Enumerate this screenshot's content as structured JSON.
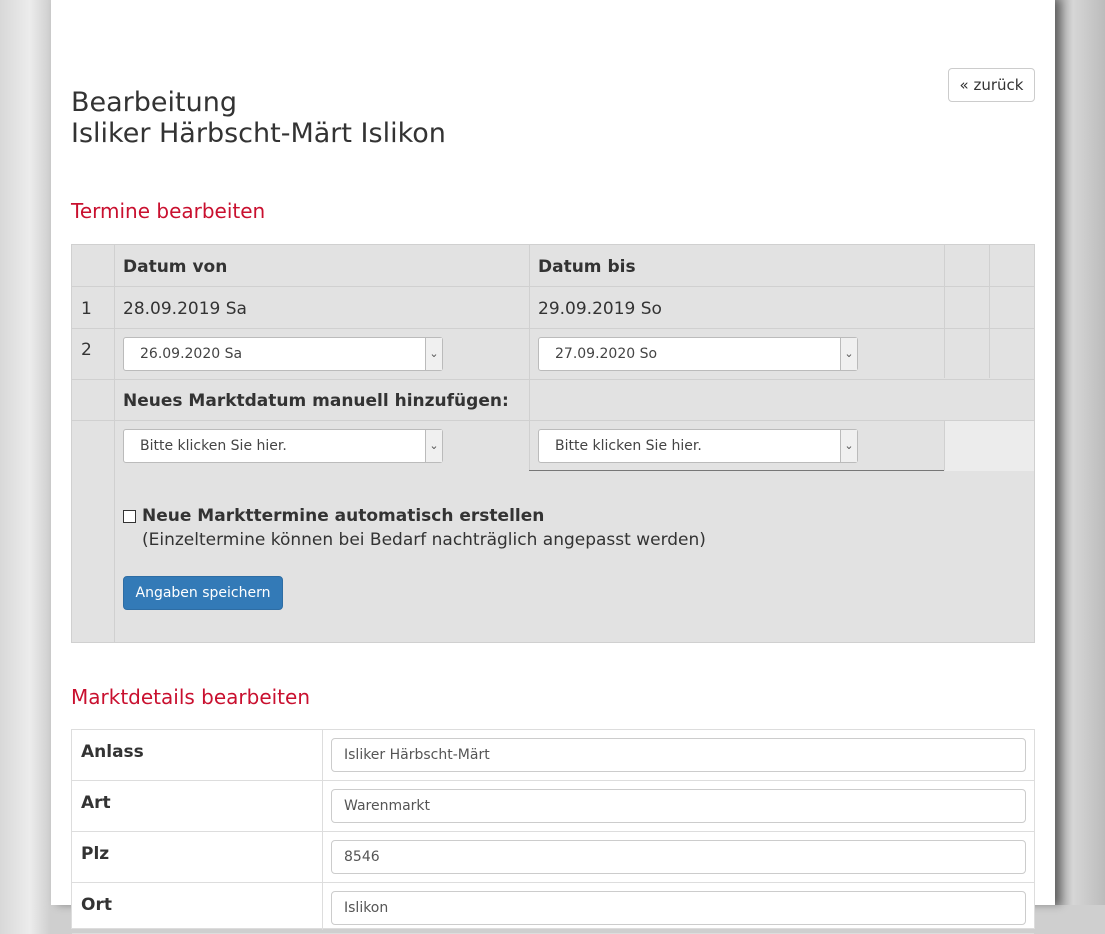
{
  "nav": {
    "back_label": "« zurück"
  },
  "page": {
    "title_line1": "Bearbeitung",
    "title_line2": "Isliker Härbscht-Märt Islikon"
  },
  "termine": {
    "section_title": "Termine bearbeiten",
    "columns": {
      "von": "Datum von",
      "bis": "Datum bis"
    },
    "rows": [
      {
        "num": "1",
        "von": "28.09.2019 Sa",
        "bis": "29.09.2019 So"
      },
      {
        "num": "2",
        "von": "26.09.2020 Sa",
        "bis": "27.09.2020 So"
      }
    ],
    "new_date_label": "Neues Marktdatum manuell hinzufügen:",
    "new_von_placeholder": "Bitte klicken Sie hier.",
    "new_bis_placeholder": "Bitte klicken Sie hier.",
    "auto_create_label": "Neue Markttermine automatisch erstellen",
    "auto_create_hint": "(Einzeltermine können bei Bedarf nachträglich angepasst werden)",
    "auto_create_checked": false,
    "save_label": "Angaben speichern"
  },
  "details": {
    "section_title": "Marktdetails bearbeiten",
    "fields": [
      {
        "label": "Anlass",
        "value": "Isliker Härbscht-Märt"
      },
      {
        "label": "Art",
        "value": "Warenmarkt"
      },
      {
        "label": "Plz",
        "value": "8546"
      },
      {
        "label": "Ort",
        "value": "Islikon"
      }
    ]
  },
  "icons": {
    "dropdown": "chevron-down-icon",
    "checkbox": "checkbox-icon"
  },
  "colors": {
    "accent_red": "#c9102f",
    "primary_button": "#337ab7",
    "table_bg": "#e2e2e2"
  }
}
